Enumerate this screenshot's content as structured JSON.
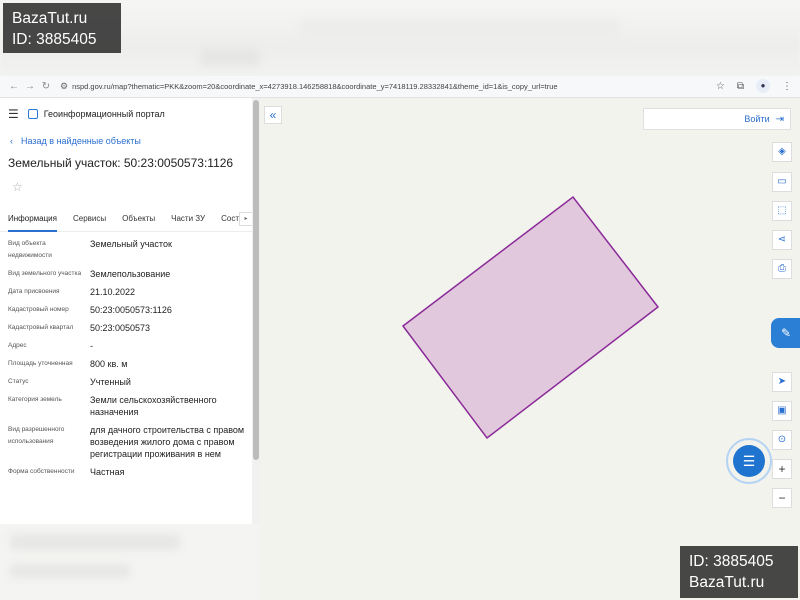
{
  "browser": {
    "url": "nspd.gov.ru/map?thematic=PKK&zoom=20&coordinate_x=4273918.146258818&coordinate_y=7418119.28332841&theme_id=1&is_copy_url=true"
  },
  "header": {
    "portal_name": "Геоинформационный портал",
    "back_link": "Назад в найденные объекты",
    "title": "Земельный участок: 50:23:0050573:1126",
    "star": "☆"
  },
  "tabs": [
    {
      "label": "Информация",
      "active": true
    },
    {
      "label": "Сервисы"
    },
    {
      "label": "Объекты"
    },
    {
      "label": "Части ЗУ"
    },
    {
      "label": "Соста"
    }
  ],
  "info": {
    "rows": [
      {
        "label": "Вид объекта недвижимости",
        "value": "Земельный участок"
      },
      {
        "label": "Вид земельного участка",
        "value": "Землепользование"
      },
      {
        "label": "Дата присвоения",
        "value": "21.10.2022"
      },
      {
        "label": "Кадастровый номер",
        "value": "50:23:0050573:1126"
      },
      {
        "label": "Кадастровый квартал",
        "value": "50:23:0050573"
      },
      {
        "label": "Адрес",
        "value": "-"
      },
      {
        "label": "Площадь уточненная",
        "value": "800 кв. м"
      },
      {
        "label": "Статус",
        "value": "Учтенный"
      },
      {
        "label": "Категория земель",
        "value": "Земли сельскохозяйственного назначения"
      },
      {
        "label": "Вид разрешенного использования",
        "value": "для дачного строительства с правом возведения жилого дома с правом регистрации проживания в нем"
      },
      {
        "label": "Форма собственности",
        "value": "Частная"
      }
    ]
  },
  "map": {
    "login_label": "Войти",
    "parcel_fill": "#e2c8dc",
    "parcel_stroke": "#8a2a99",
    "map_bg": "#f3f3ee",
    "accent": "#2b6fd0"
  },
  "watermark": {
    "site": "BazaTut.ru",
    "id": "ID: 3885405"
  }
}
